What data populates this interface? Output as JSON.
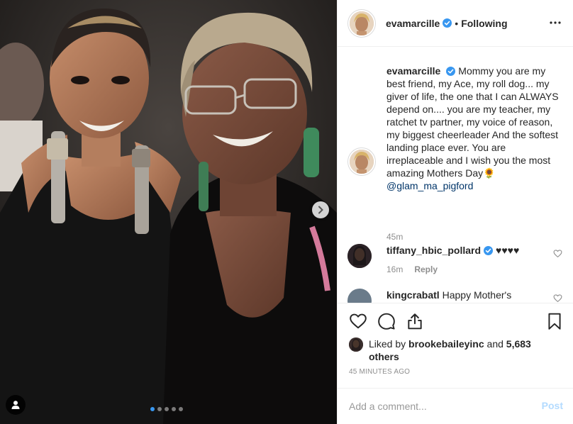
{
  "post": {
    "author": "evamarcille",
    "follow_status": "Following",
    "caption_text": "Mommy you are my best friend, my Ace, my roll dog... my giver of life, the one that I can ALWAYS depend on.... you are my teacher, my ratchet tv partner, my voice of reason, my biggest cheerleader And the softest landing place ever. You are irreplaceable and I wish you the most amazing Mothers Day🌻",
    "caption_mention": "@glam_ma_pigford",
    "caption_time": "45m"
  },
  "comments": [
    {
      "username": "tiffany_hbic_pollard",
      "text": "♥♥♥♥",
      "time": "16m",
      "reply_label": "Reply",
      "verified": true
    },
    {
      "username": "kingcrabatl",
      "text": "Happy Mother's",
      "verified": false
    }
  ],
  "likes": {
    "prefix": "Liked by",
    "user": "brookebaileyinc",
    "middle": "and",
    "others": "5,683 others"
  },
  "posted_time": "45 MINUTES AGO",
  "add_comment": {
    "placeholder": "Add a comment...",
    "post_label": "Post"
  },
  "carousel": {
    "count": 5,
    "active": 1
  },
  "colors": {
    "verified_blue": "#3897f0",
    "link": "#003569",
    "post_disabled": "#b3dbff"
  }
}
